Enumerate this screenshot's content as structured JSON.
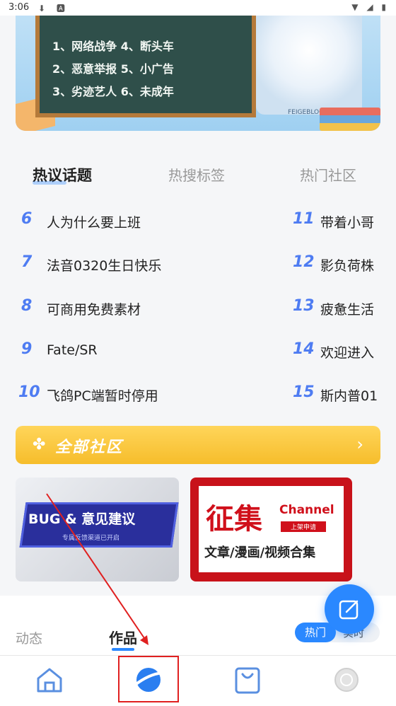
{
  "status_bar": {
    "time": "3:06",
    "left_icons": "⬇ 🅰",
    "right_icons": "▼ ◢ ▮"
  },
  "banner": {
    "board_lines": [
      "1、网络战争  4、断头车",
      "2、恶意举报  5、小广告",
      "3、劣迹艺人  6、未成年"
    ],
    "badge": "FEIGEBLOG"
  },
  "topic_tabs": [
    "热议话题",
    "热搜标签",
    "热门社区"
  ],
  "topics_left": [
    {
      "rank": "6",
      "title": "人为什么要上班"
    },
    {
      "rank": "7",
      "title": "法音0320生日快乐"
    },
    {
      "rank": "8",
      "title": "可商用免费素材"
    },
    {
      "rank": "9",
      "title": "Fate/SR"
    },
    {
      "rank": "10",
      "title": "飞鸽PC端暂时停用"
    }
  ],
  "topics_right": [
    {
      "rank": "11",
      "title": "带着小哥"
    },
    {
      "rank": "12",
      "title": "影负荷株"
    },
    {
      "rank": "13",
      "title": "疲惫生活"
    },
    {
      "rank": "14",
      "title": "欢迎进入"
    },
    {
      "rank": "15",
      "title": "斯内普01"
    }
  ],
  "all_community": {
    "icon": "clover-icon",
    "label": "全部社区",
    "arrow": "›"
  },
  "cards": {
    "bug": {
      "title": "BUG & 意见建议",
      "subtitle": "专属反馈渠道已开启"
    },
    "collect": {
      "title": "征集",
      "channel": "Channel",
      "tag": "上架申请",
      "bottom": "文章/漫画/视频合集"
    }
  },
  "lower_tabs": {
    "dynamic": "动态",
    "works": "作品"
  },
  "sort": {
    "hot": "热门",
    "realtime": "实时"
  },
  "nav": {
    "items": [
      "home-icon",
      "planet-icon",
      "shopping-bag-icon",
      "profile-icon"
    ]
  },
  "colors": {
    "accent": "#2a88ff",
    "rank": "#4e7cf2",
    "yellow": "#f6bd2b",
    "red": "#c8121a"
  }
}
